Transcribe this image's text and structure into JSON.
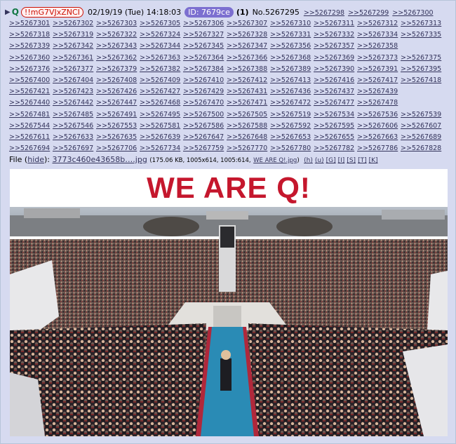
{
  "post": {
    "name": "Q",
    "tripcode": "!!mG7VJxZNCI",
    "datetime": "02/19/19 (Tue) 14:18:03",
    "id_label": "ID: 7679ce",
    "post_count": "(1)",
    "post_number": "No.5267295",
    "backlinks": [
      ">>5267298",
      ">>5267299",
      ">>5267300",
      ">>5267301",
      ">>5267302",
      ">>5267303",
      ">>5267305",
      ">>5267306",
      ">>5267307",
      ">>5267310",
      ">>5267311",
      ">>5267312",
      ">>5267313",
      ">>5267318",
      ">>5267319",
      ">>5267322",
      ">>5267324",
      ">>5267327",
      ">>5267328",
      ">>5267331",
      ">>5267332",
      ">>5267334",
      ">>5267335",
      ">>5267339",
      ">>5267342",
      ">>5267343",
      ">>5267344",
      ">>5267345",
      ">>5267347",
      ">>5267356",
      ">>5267357",
      ">>5267358",
      ">>5267360",
      ">>5267361",
      ">>5267362",
      ">>5267363",
      ">>5267364",
      ">>5267366",
      ">>5267368",
      ">>5267369",
      ">>5267373",
      ">>5267375",
      ">>5267376",
      ">>5267377",
      ">>5267379",
      ">>5267382",
      ">>5267384",
      ">>5267388",
      ">>5267389",
      ">>5267390",
      ">>5267391",
      ">>5267395",
      ">>5267400",
      ">>5267404",
      ">>5267408",
      ">>5267409",
      ">>5267410",
      ">>5267412",
      ">>5267413",
      ">>5267416",
      ">>5267417",
      ">>5267418",
      ">>5267421",
      ">>5267423",
      ">>5267426",
      ">>5267427",
      ">>5267429",
      ">>5267431",
      ">>5267436",
      ">>5267437",
      ">>5267439",
      ">>5267440",
      ">>5267442",
      ">>5267447",
      ">>5267468",
      ">>5267470",
      ">>5267471",
      ">>5267472",
      ">>5267477",
      ">>5267478",
      ">>5267481",
      ">>5267485",
      ">>5267491",
      ">>5267495",
      ">>5267500",
      ">>5267505",
      ">>5267519",
      ">>5267534",
      ">>5267536",
      ">>5267539",
      ">>5267544",
      ">>5267546",
      ">>5267553",
      ">>5267581",
      ">>5267586",
      ">>5267588",
      ">>5267592",
      ">>5267595",
      ">>5267606",
      ">>5267607",
      ">>5267611",
      ">>5267633",
      ">>5267635",
      ">>5267639",
      ">>5267647",
      ">>5267648",
      ">>5267653",
      ">>5267655",
      ">>5267663",
      ">>5267689",
      ">>5267694",
      ">>5267697",
      ">>5267706",
      ">>5267734",
      ">>5267759",
      ">>5267770",
      ">>5267780",
      ">>5267782",
      ">>5267786",
      ">>5267828"
    ]
  },
  "file": {
    "label": "File",
    "hide": "hide",
    "filename": "3773c460e43658b….jpg",
    "meta": "(175.06 KB, 1005x614, 1005:614,",
    "original_name": "WE ARE Q!.jpg",
    "tail": ")",
    "tools": [
      "(h)",
      "(u)",
      "[G]",
      "[I]",
      "[S]",
      "[T]",
      "[K]"
    ]
  },
  "image": {
    "banner_text": "WE ARE Q!"
  },
  "colors": {
    "post_bg": "#d6daf0",
    "link": "#34345c",
    "name": "#117743",
    "trip": "#cc1105",
    "id_badge": "#7c6fd0",
    "banner_text": "#c5172d"
  }
}
